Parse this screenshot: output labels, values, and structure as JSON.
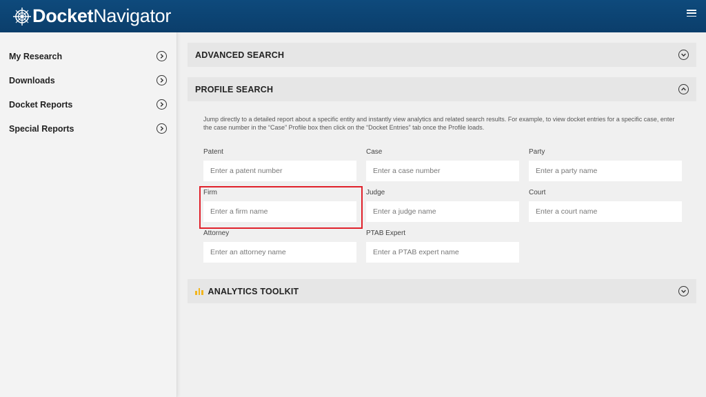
{
  "app": {
    "logo_bold": "Docket",
    "logo_light": "Navigator",
    "colors": {
      "header": "#0b3e6b",
      "highlight": "#e0202a",
      "analytics_icon": "#f2b51c"
    }
  },
  "sidebar": {
    "items": [
      {
        "label": "My Research",
        "icon": "chevron-right-circle-icon"
      },
      {
        "label": "Downloads",
        "icon": "chevron-right-circle-icon"
      },
      {
        "label": "Docket Reports",
        "icon": "chevron-right-circle-icon"
      },
      {
        "label": "Special Reports",
        "icon": "chevron-right-circle-icon"
      }
    ]
  },
  "panels": {
    "advanced": {
      "title": "ADVANCED SEARCH",
      "state": "collapsed"
    },
    "profile": {
      "title": "PROFILE SEARCH",
      "state": "expanded",
      "description": "Jump directly to a detailed report about a specific entity and instantly view analytics and related search results. For example, to view docket entries for a specific case, enter the case number in the “Case” Profile box then click on the “Docket Entries” tab once the Profile loads.",
      "fields": [
        {
          "label": "Patent",
          "placeholder": "Enter a patent number",
          "value": ""
        },
        {
          "label": "Case",
          "placeholder": "Enter a case number",
          "value": ""
        },
        {
          "label": "Party",
          "placeholder": "Enter a party name",
          "value": ""
        },
        {
          "label": "Firm",
          "placeholder": "Enter a firm name",
          "value": ""
        },
        {
          "label": "Judge",
          "placeholder": "Enter a judge name",
          "value": ""
        },
        {
          "label": "Court",
          "placeholder": "Enter a court name",
          "value": ""
        },
        {
          "label": "Attorney",
          "placeholder": "Enter an attorney name",
          "value": ""
        },
        {
          "label": "PTAB Expert",
          "placeholder": "Enter a PTAB expert name",
          "value": ""
        }
      ]
    },
    "analytics": {
      "title": "ANALYTICS TOOLKIT",
      "state": "collapsed",
      "icon": "bar-chart-icon"
    }
  }
}
